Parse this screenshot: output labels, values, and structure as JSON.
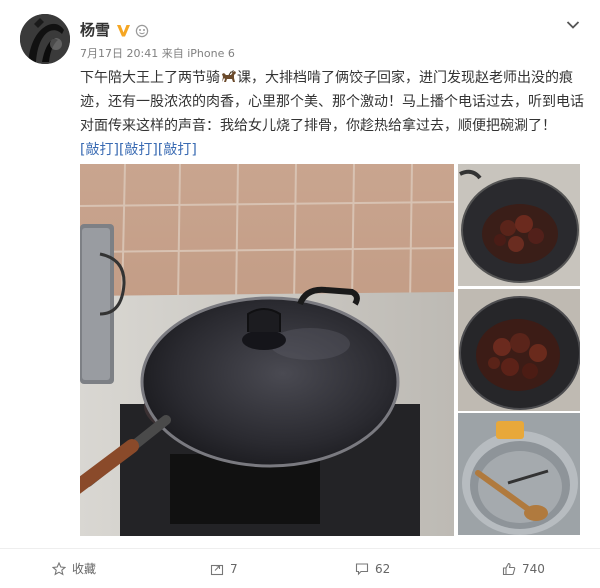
{
  "post": {
    "author": {
      "name": "杨雪",
      "verified": true,
      "verify_color": "#f5a623"
    },
    "meta": {
      "time": "7月17日 20:41",
      "source_prefix": "来自",
      "source": "iPhone 6"
    },
    "content": {
      "text_before_emoji": "下午陪大王上了两节骑",
      "emoji": "horse-emoji",
      "text_after_emoji": "课，大排档啃了俩饺子回家，进门发现赵老师出没的痕迹，还有一股浓浓的肉香，心里那个美、那个激动！马上播个电话过去，听到电话对面传来这样的声音：我给女儿烧了排骨，你趁热给拿过去，顺便把碗涮了！",
      "tags": [
        "[敲打]",
        "[敲打]",
        "[敲打]"
      ]
    },
    "photos": {
      "main": "wok-with-glass-lid-on-stove",
      "side": [
        "wok-with-braised-ribs",
        "wok-with-braised-ribs-closeup",
        "sink-with-washed-pot-and-spatula"
      ]
    },
    "actions": {
      "collect_label": "收藏",
      "repost_count": "7",
      "comment_count": "62",
      "like_count": "740"
    },
    "colors": {
      "link": "#3a6bb3",
      "meta": "#808080",
      "text": "#333333"
    }
  }
}
